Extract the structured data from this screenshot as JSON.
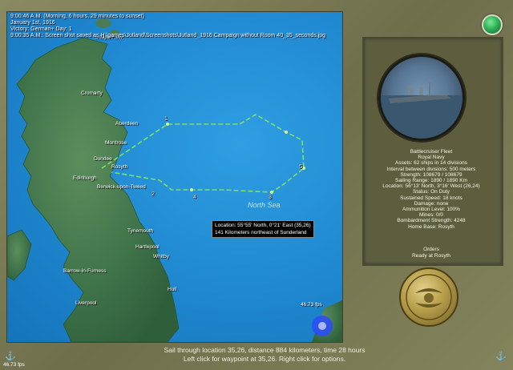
{
  "status": {
    "time": "9:00:46 A.M. (Morning, 6 hours, 29 minutes to sunset)",
    "date": "January 1st, 1916",
    "victory": "Victory: German+ Day: 1",
    "screenshot_note": "9:00:35 A.M.: Screen shot saved as H:\\games\\Jutland\\Screenshots\\Jutland_1916 Campaign without Room 40_35_seconds.jpg"
  },
  "map": {
    "sea_label": "North Sea",
    "towns": [
      "Scapa Flow",
      "Cromarty",
      "Aberdeen",
      "Montrose",
      "Dundee",
      "Rosyth",
      "Edinburgh",
      "Berwick-upon-Tweed",
      "Tynemouth",
      "Hartlepool",
      "Whitby",
      "Barrow-in-Furness",
      "Liverpool",
      "Hull"
    ],
    "waypoint_numbers": [
      "1",
      "2",
      "3",
      "4",
      "5"
    ],
    "fps_map": "46.73 fps"
  },
  "tooltip": {
    "line1": "Location: 55°55' North, 0°21' East (35,26)",
    "line2": "141 Kilometers northeast of Sunderland"
  },
  "unit": {
    "name": "Battlecruiser Fleet",
    "navy": "Royal Navy",
    "assets": "Assets: 62 ships in 14 divisions",
    "interval": "Interval between divisions: 500 meters",
    "strength": "Strength: 108679 / 108679",
    "sailing_range": "Sailing Range: 1890 / 1890 Km",
    "location": "Location:  56°13' North, 3°16' West (26,24)",
    "status": "Status: On Duty",
    "speed": "Sustained Speed: 18 knots",
    "damage": "Damage: none",
    "ammo": "Ammunition Level: 100%",
    "mines": "Mines: 0/0",
    "bombardment": "Bombardment Strength: 4248",
    "home_base": "Home Base: Rosyth"
  },
  "orders": {
    "title": "Orders",
    "text": "Ready at Rosyth"
  },
  "bottom": {
    "line1": "Sail through location 35,26, distance 884 kilometers, time 28 hours",
    "line2": "Left click for waypoint at 35,26. Right click for options."
  },
  "fps_bottom": "46.73 fps",
  "icons": {
    "end_turn": "green-round-button",
    "left_corner": "anchor-icon",
    "right_corner": "anchor-icon",
    "medal": "royal-navy-emblem"
  },
  "colors": {
    "sea": "#1e87cf",
    "land": "#3e7a4f",
    "route": "#7de067",
    "panel": "#5e5e3f"
  }
}
